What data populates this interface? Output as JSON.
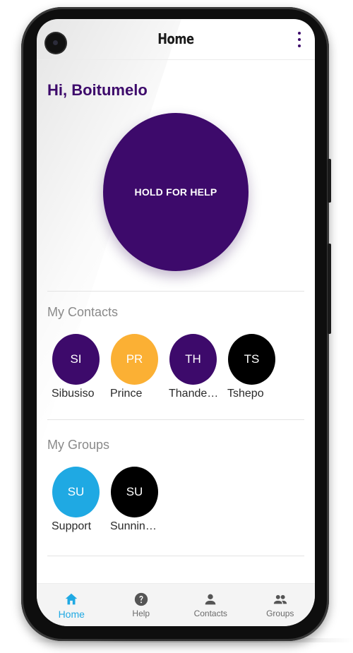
{
  "appbar": {
    "title": "Home",
    "menu_icon": "more-vert-icon"
  },
  "greeting": "Hi, Boitumelo",
  "help_button": {
    "label": "HOLD FOR HELP",
    "color": "#3d0a6b"
  },
  "contacts": {
    "title": "My Contacts",
    "items": [
      {
        "initials": "SI",
        "name": "Sibusiso",
        "color": "#3d0a6b"
      },
      {
        "initials": "PR",
        "name": "Prince",
        "color": "#fbb034"
      },
      {
        "initials": "TH",
        "name": "Thande…",
        "color": "#3d0a6b"
      },
      {
        "initials": "TS",
        "name": "Tshepo",
        "color": "#000000"
      }
    ]
  },
  "groups": {
    "title": "My Groups",
    "items": [
      {
        "initials": "SU",
        "name": "Support",
        "color": "#1fa9e3"
      },
      {
        "initials": "SU",
        "name": "Sunnin…",
        "color": "#000000"
      }
    ]
  },
  "bottom_nav": {
    "items": [
      {
        "label": "Home",
        "icon": "home-icon",
        "active": true
      },
      {
        "label": "Help",
        "icon": "help-icon",
        "active": false
      },
      {
        "label": "Contacts",
        "icon": "person-icon",
        "active": false
      },
      {
        "label": "Groups",
        "icon": "group-icon",
        "active": false
      }
    ]
  },
  "colors": {
    "primary": "#3d0a6b",
    "accent": "#1fa9e3",
    "yellow": "#fbb034"
  }
}
